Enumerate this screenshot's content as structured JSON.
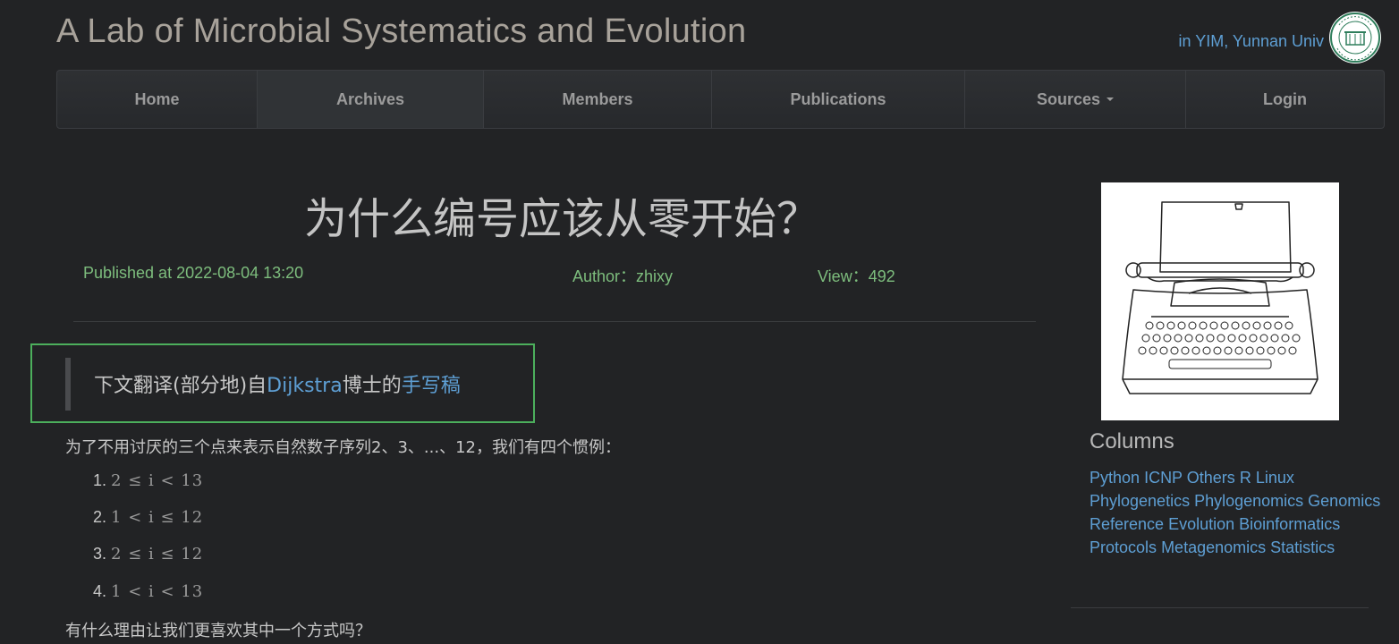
{
  "site": {
    "title": "A Lab of Microbial Systematics and Evolution",
    "affil_prefix": "in ",
    "affil_link1": "YIM",
    "affil_sep": ", ",
    "affil_link2": "Yunnan Univ",
    "logo_text": "YUNNAN UNIVERSITY"
  },
  "nav": {
    "items": [
      {
        "label": "Home"
      },
      {
        "label": "Archives"
      },
      {
        "label": "Members"
      },
      {
        "label": "Publications"
      },
      {
        "label": "Sources"
      },
      {
        "label": "Login"
      }
    ],
    "active": "Archives"
  },
  "post": {
    "title": "为什么编号应该从零开始？",
    "published": "Published at 2022-08-04 13:20",
    "author": "Author：zhixy",
    "views": "View：492",
    "quote_pre": "下文翻译(部分地)自",
    "quote_link1": "Dijkstra",
    "quote_mid": "博士的",
    "quote_link2": "手写稿",
    "intro": "为了不用讨厌的三个点来表示自然数子序列2、3、...、12，我们有四个惯例：",
    "list": [
      {
        "num": "1.",
        "expr": "2 ≤ i < 13"
      },
      {
        "num": "2.",
        "expr": "1 < i ≤ 12"
      },
      {
        "num": "3.",
        "expr": "2 ≤ i ≤ 12"
      },
      {
        "num": "4.",
        "expr": "1 < i < 13"
      }
    ],
    "question": "有什么理由让我们更喜欢其中一个方式吗？"
  },
  "sidebar": {
    "columns_title": "Columns",
    "columns": [
      "Python",
      "ICNP",
      "Others",
      "R",
      "Linux",
      "Phylogenetics",
      "Phylogenomics",
      "Genomics",
      "Reference",
      "Evolution",
      "Bioinformatics",
      "Protocols",
      "Metagenomics",
      "Statistics"
    ]
  }
}
